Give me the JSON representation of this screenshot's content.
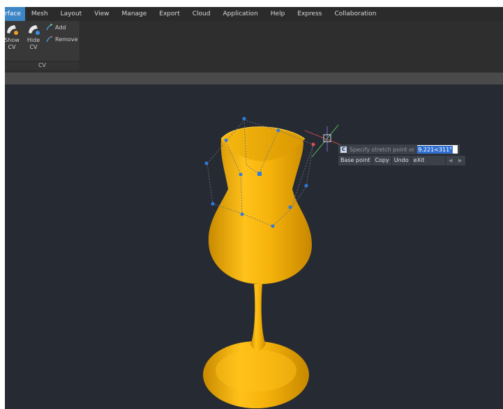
{
  "menubar": {
    "items": [
      "rface",
      "Mesh",
      "Layout",
      "View",
      "Manage",
      "Export",
      "Cloud",
      "Application",
      "Help",
      "Express",
      "Collaboration"
    ]
  },
  "ribbon": {
    "show_cv": "Show CV",
    "hide_cv": "Hide CV",
    "add": "Add",
    "remove": "Remove",
    "panel_title": "CV"
  },
  "prompt": {
    "text": "Specify stretch point or",
    "value": "9.221<311°",
    "options": [
      "Base point",
      "Copy",
      "Undo",
      "eXit"
    ]
  },
  "colors": {
    "menu_active": "#3d86c6",
    "model_gold": "#f0b40a",
    "cv_point": "#2f7be0",
    "viewport_bg": "#262b33"
  }
}
